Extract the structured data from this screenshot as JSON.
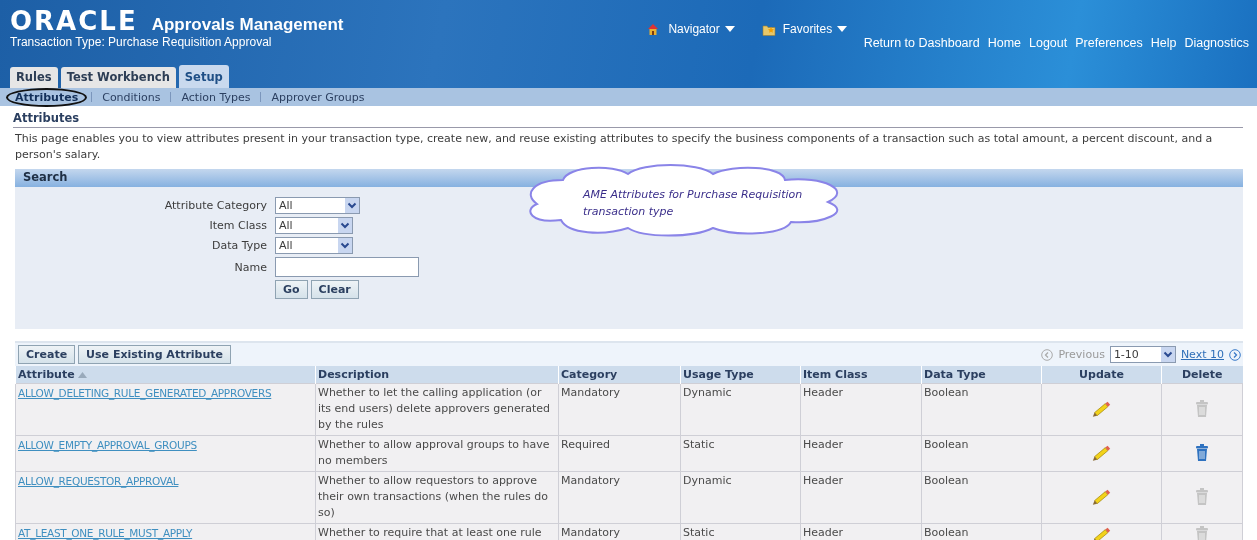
{
  "header": {
    "logo": "ORACLE",
    "app_title": "Approvals Management",
    "subtitle": "Transaction Type: Purchase Requisition Approval",
    "menus": [
      {
        "label": "Navigator",
        "kind": "home"
      },
      {
        "label": "Favorites",
        "kind": "folder"
      }
    ],
    "global_links": [
      "Return to Dashboard",
      "Home",
      "Logout",
      "Preferences",
      "Help",
      "Diagnostics"
    ]
  },
  "tabs": [
    {
      "label": "Rules",
      "selected": false
    },
    {
      "label": "Test Workbench",
      "selected": false
    },
    {
      "label": "Setup",
      "selected": true
    }
  ],
  "subtabs": [
    {
      "label": "Attributes",
      "selected": true,
      "circled": true
    },
    {
      "label": "Conditions",
      "selected": false,
      "circled": false
    },
    {
      "label": "Action Types",
      "selected": false,
      "circled": false
    },
    {
      "label": "Approver Groups",
      "selected": false,
      "circled": false
    }
  ],
  "page_title": "Attributes",
  "description": "This page enables you to view attributes present in your transaction type, create new, and reuse existing attributes to specify the business components of a transaction such as total amount, a percent discount, and a person's salary.",
  "search": {
    "title": "Search",
    "fields": [
      {
        "label": "Attribute Category",
        "kind": "select",
        "value": "All"
      },
      {
        "label": "Item Class",
        "kind": "select",
        "value": "All"
      },
      {
        "label": "Data Type",
        "kind": "select",
        "value": "All"
      },
      {
        "label": "Name",
        "kind": "text"
      }
    ],
    "buttons": [
      "Go",
      "Clear"
    ]
  },
  "callout": "AME Attributes for Purchase Requisition transaction type",
  "table": {
    "buttons": [
      "Create",
      "Use Existing Attribute"
    ],
    "pager": {
      "previous": "Previous",
      "range": "1-10",
      "next": "Next 10"
    },
    "columns": [
      "Attribute",
      "Description",
      "Category",
      "Usage Type",
      "Item Class",
      "Data Type",
      "Update",
      "Delete"
    ],
    "rows": [
      {
        "attribute": "ALLOW_DELETING_RULE_GENERATED_APPROVERS",
        "description": "Whether to let the calling application (or its end users) delete approvers generated by the rules",
        "category": "Mandatory",
        "usage_type": "Dynamic",
        "item_class": "Header",
        "data_type": "Boolean",
        "delete_enabled": false
      },
      {
        "attribute": "ALLOW_EMPTY_APPROVAL_GROUPS",
        "description": "Whether to allow approval groups to have no members",
        "category": "Required",
        "usage_type": "Static",
        "item_class": "Header",
        "data_type": "Boolean",
        "delete_enabled": true
      },
      {
        "attribute": "ALLOW_REQUESTOR_APPROVAL",
        "description": "Whether to allow requestors to approve their own transactions (when the rules do so)",
        "category": "Mandatory",
        "usage_type": "Dynamic",
        "item_class": "Header",
        "data_type": "Boolean",
        "delete_enabled": false
      },
      {
        "attribute": "AT_LEAST_ONE_RULE_MUST_APPLY",
        "description": "Whether to require that at least one rule",
        "category": "Mandatory",
        "usage_type": "Static",
        "item_class": "Header",
        "data_type": "Boolean",
        "delete_enabled": false
      }
    ]
  }
}
